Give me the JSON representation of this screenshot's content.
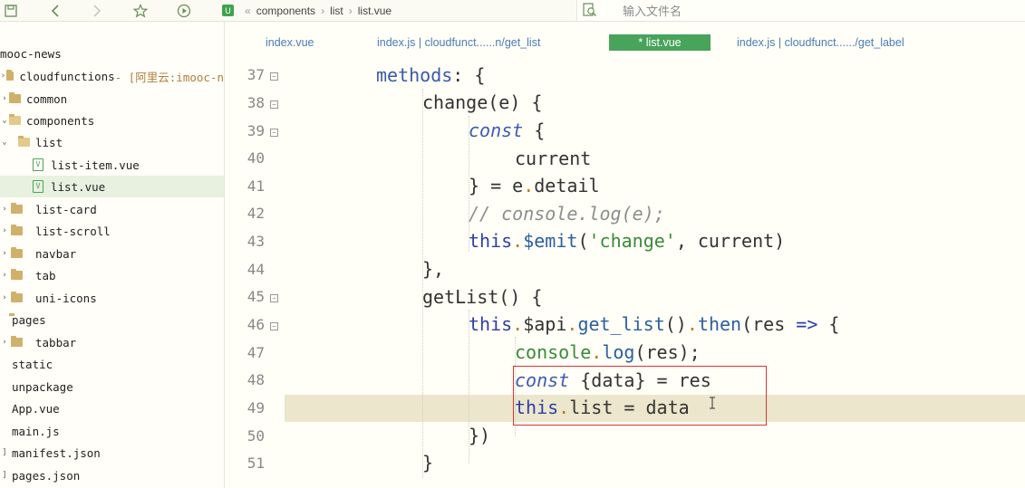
{
  "toolbar": {
    "icons": [
      "save-icon",
      "back-icon",
      "forward-icon",
      "star-icon",
      "run-icon"
    ],
    "breadcrumb": [
      "components",
      "list",
      "list.vue"
    ],
    "breadcrumb_sep": "«",
    "search_placeholder": "输入文件名"
  },
  "sidebar": {
    "items": [
      {
        "label": "mooc-news",
        "type": "project"
      },
      {
        "label": "cloudfunctions",
        "suffix": " - [阿里云:imooc-n",
        "type": "folder"
      },
      {
        "label": "common",
        "type": "folder"
      },
      {
        "label": "components",
        "type": "folder"
      },
      {
        "label": "list",
        "type": "folder-open"
      },
      {
        "label": "list-item.vue",
        "type": "vue"
      },
      {
        "label": "list.vue",
        "type": "vue",
        "selected": true
      },
      {
        "label": "list-card",
        "type": "folder"
      },
      {
        "label": "list-scroll",
        "type": "folder"
      },
      {
        "label": "navbar",
        "type": "folder"
      },
      {
        "label": "tab",
        "type": "folder"
      },
      {
        "label": "uni-icons",
        "type": "folder"
      },
      {
        "label": "pages",
        "type": "folder"
      },
      {
        "label": "tabbar",
        "type": "folder"
      },
      {
        "label": "static",
        "type": "folder"
      },
      {
        "label": "unpackage",
        "type": "folder"
      },
      {
        "label": "App.vue",
        "type": "file"
      },
      {
        "label": "main.js",
        "type": "file"
      },
      {
        "label": "manifest.json",
        "type": "file"
      },
      {
        "label": "pages.json",
        "type": "file"
      }
    ]
  },
  "tabs": [
    {
      "label": "index.vue"
    },
    {
      "label": "index.js | cloudfunct......n/get_list"
    },
    {
      "label": "* list.vue",
      "active": true
    },
    {
      "label": "index.js | cloudfunct....../get_label"
    }
  ],
  "editor": {
    "line_numbers": [
      "37",
      "38",
      "39",
      "40",
      "41",
      "42",
      "43",
      "44",
      "45",
      "46",
      "47",
      "48",
      "49",
      "50",
      "51"
    ],
    "fold_marker": "−",
    "code": {
      "l37": {
        "a": "methods",
        "b": ": {"
      },
      "l38": {
        "a": "change(e) {"
      },
      "l39": {
        "a": "const",
        "b": " {"
      },
      "l40": {
        "a": "current"
      },
      "l41": {
        "a": "} = e",
        "b": ".",
        "c": "detail"
      },
      "l42": {
        "a": "// console.log(e);"
      },
      "l43": {
        "a": "this",
        "b": ".",
        "c": "$emit",
        "d": "(",
        "e": "'change'",
        "f": ", current)"
      },
      "l44": {
        "a": "},"
      },
      "l45": {
        "a": "getList() {"
      },
      "l46": {
        "a": "this",
        "b": ".",
        "c": "$api",
        "d": ".",
        "e": "get_list",
        "f": "()",
        "g": ".",
        "h": "then",
        "i": "(res ",
        "j": "=>",
        "k": " {"
      },
      "l47": {
        "a": "console",
        "b": ".",
        "c": "log",
        "d": "(res);"
      },
      "l48": {
        "a": "const",
        "b": " {data} = res"
      },
      "l49": {
        "a": "this",
        "b": ".",
        "c": "list = data"
      },
      "l50": {
        "a": "})"
      },
      "l51": {
        "a": "}"
      }
    }
  }
}
